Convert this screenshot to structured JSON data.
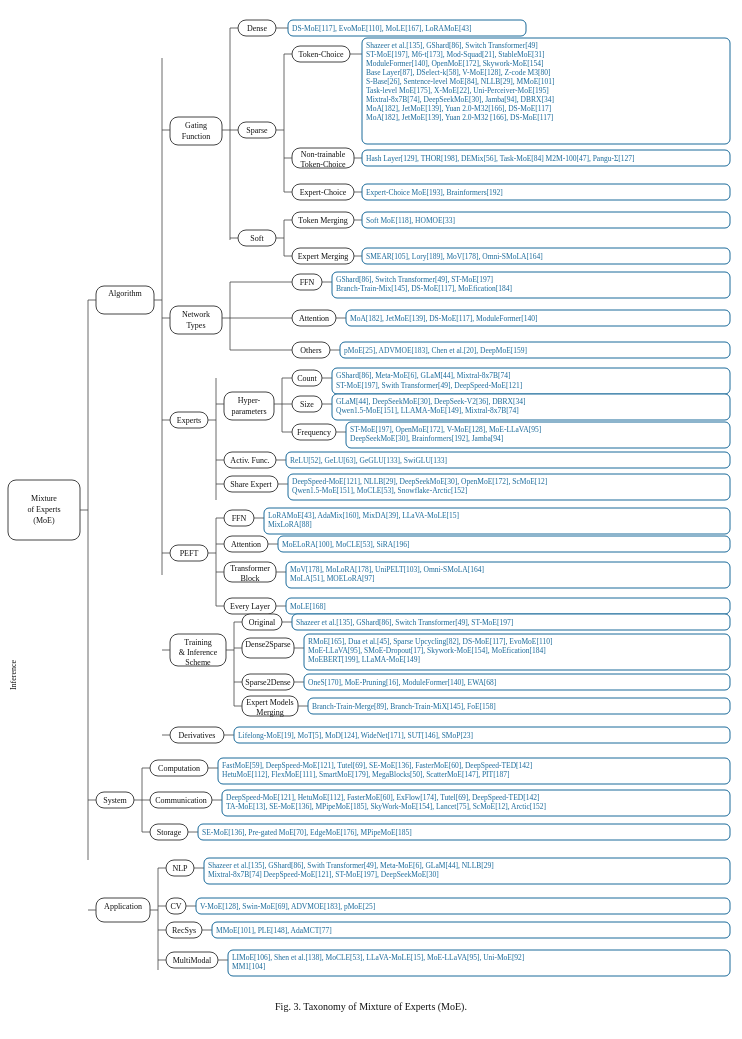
{
  "figure": {
    "caption": "Fig. 3.  Taxonomy of Mixture of Experts (MoE).",
    "title": "Mixture of Experts (MoE)"
  },
  "nodes": {
    "root": "Mixture of Experts (MoE)",
    "level1": [
      "Algorithm",
      "System",
      "Application"
    ],
    "algorithm": {
      "gating_function": {
        "dense": "DS-MoE[117], EvoMoE[110], MoLE[167], LoRAMoE[43]",
        "sparse": {
          "token_choice": "Shazeer et al.[135], GShard[86], Switch Transformer[49]\nST-MoE[197], M6-t[173], Mod-Squad[21], StableMoE[31]\nModuleFormer[140], OpenMoE[172], Skywork-MoE[154]\nBase Layer[87], DSelect-k[58], V-MoE[128], Z-code M3[80]\nS-Base[26], Sentence-level MoE[84], NLLB[29], MMoE[101]\nTask-level MoE[175], X-MoE[22], Uni-Perceiver-MoE[195]\nMixtral-8x7B[74], DeepSeekMoE[30], Jamba[94], DBRX[34]\nMoA[182], JetMoE[139], Yuan 2.0-M32[166], DS-MoE[117]",
          "non_trainable": "Hash Layer[129], THOR[198], DEMix[56], Task-MoE[84]\nM2M-100[47], Pangu-Σ[127]",
          "expert_choice": "Expert-Choice MoE[193], Brainformers[192]"
        },
        "soft": {
          "token_merging": "Soft MoE[118], HOMOE[33]",
          "expert_merging": "SMEAR[105], Lory[189], MoV[178], Omni-SMoLA[164]"
        }
      },
      "network_types": {
        "ffn": "GShard[86], Switch Transformer[49], ST-MoE[197]\nBranch-Train-Mix[145], DS-MoE[117], MoEfication[184]",
        "attention": "MoA[182], JetMoE[139], DS-MoE[117], ModuleFormer[140]",
        "others": "pMoE[25], ADVMOE[183], Chen et al.[20], DeepMoE[159]"
      },
      "experts": {
        "hyperparams": {
          "count": "GShard[86], Meta-MoE[6], GLaM[44], Mixtral-8x7B[74]\nST-MoE[197], Swith Transformer[49], DeepSpeed-MoE[121]",
          "size": "GLaM[44], DeepSeekMoE[30], DeepSeek-V2[36], DBRX[34]\nQwen1.5-MoE[151], LLAMA-MoE[149], Mixtral-8x7B[74]",
          "frequency": "ST-MoE[197], OpenMoE[172], V-MoE[128], MoE-LLaVA[95]\nDeepSeekMoE[30], Brainformers[192], Jamba[94]"
        },
        "activ_func": "ReLU[52], GeLU[63], GeGLU[133], SwiGLU[133]",
        "share_expert": "DeepSpeed-MoE[121], NLLB[29], DeepSeekMoE[30], OpenMoE[172], ScMoE[12]\nQwen1.5-MoE[151], MoCLE[53], Snowflake-Arctic[152]"
      },
      "peft": {
        "ffn": "LoRAMoE[43], AdaMix[160], MixDA[39], LLaVA-MoLE[15]\nMixLoRA[88]",
        "attention": "MoELoRA[100], MoCLE[53], SiRA[196]",
        "transformer_block": "MoV[178], MoLoRA[178], UniPELT[103], Omni-SMoLA[164]\nMoLA[51], MOELoRA[97]",
        "every_layer": "MoLE[168]"
      }
    },
    "training": {
      "original": "Shazeer et al.[135], GShard[86], Switch Transformer[49], ST-MoE[197]",
      "dense2sparse": "RMoE[165], Dua et al.[45], Sparse Upcycling[82], DS-MoE[117], EvoMoE[110]\nMoE-LLaVA[95], SMoE-Dropout[17], Skywork-MoE[154], MoEfication[184]\nMoEBERT[199], LLaMM-MoE[149]",
      "sparse2dense": "OneS[170], MoE-Pruning[16], ModuleFormer[140], EWA[68]",
      "expert_merging": "Branch-Train-Merge[89], Branch-Train-MiX[145], FoE[158]"
    },
    "derivatives": "Lifelong-MoE[19], MoT[5], MoD[124], WideNet[171], SUT[146], SMoP[23]",
    "system": {
      "computation": "FastMoE[59], DeepSpeed-MoE[121], Tutel[69], SE-MoE[136], FasterMoE[60], DeepSpeed-TED[142]\nHetuMoE[112], FlexMoE[111], SmartMoE[179], MegaBlocks[50], ScatterMoE[147], PIT[187]",
      "communication": "DeepSpeed-MoE[121], HetuMoE[112], FasterMoE[60], ExFlow[174], Tutel[69], DeepSpeed-TED[142]\nTA-MoE[13], SE-MoE[136], MPipeMoE[185], SkyWork-MoE[154], Lancet[75], ScMoE[12], Arctic[152]",
      "storage": "SE-MoE[136], Pre-gated MoE[70], EdgeMoE[176], MPipeMoE[185]"
    },
    "application": {
      "nlp": "Shazeer et al.[135], GShard[86], Swith Transformer[49], Meta-MoE[6], GLaM[44], NLLB[29]\nMixtral-8x7B[74] DeepSpeed-MoE[121], ST-MoE[197], DeepSeekMoE[30]",
      "cv": "V-MoE[128], Swin-MoE[69], ADVMOE[183], pMoE[25]",
      "recsys": "MMoE[101], PLE[148], AdaMCT[77]",
      "multimodal": "LIMoE[106], Shen et al.[138], MoCLE[53], LLaVA-MoLE[15], MoE-LLaVA[95], Uni-MoE[92]\nMM1[104]"
    }
  }
}
